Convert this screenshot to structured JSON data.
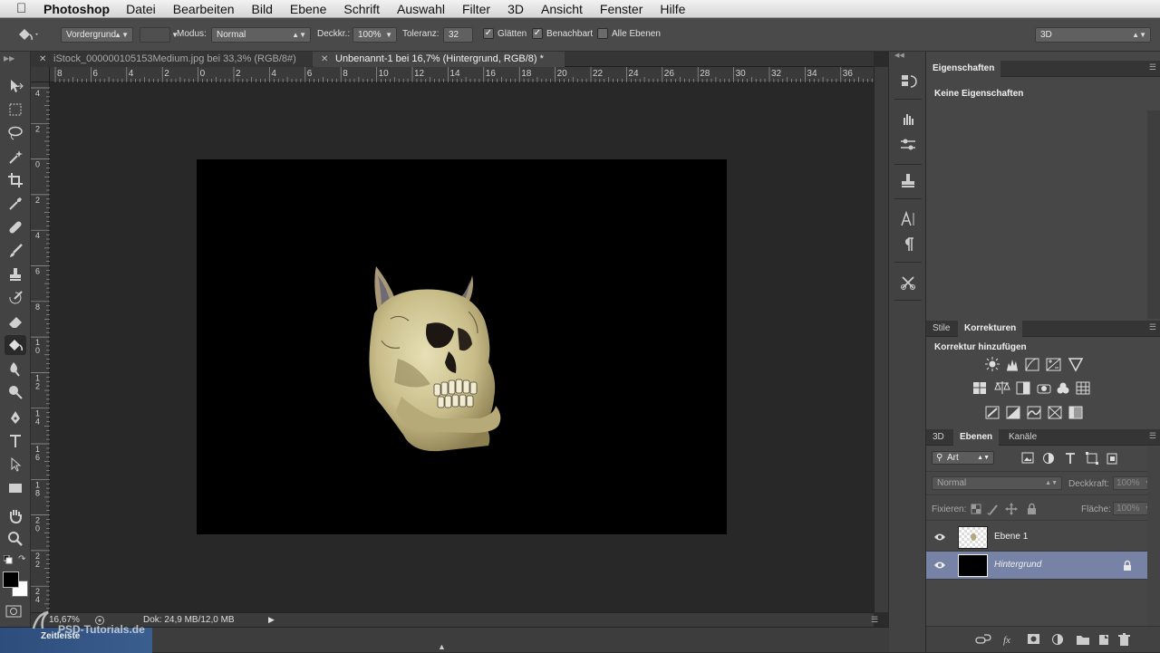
{
  "menubar": {
    "app": "Photoshop",
    "items": [
      "Datei",
      "Bearbeiten",
      "Bild",
      "Ebene",
      "Schrift",
      "Auswahl",
      "Filter",
      "3D",
      "Ansicht",
      "Fenster",
      "Hilfe"
    ]
  },
  "options": {
    "fill_source": "Vordergrund",
    "mode_label": "Modus:",
    "mode_value": "Normal",
    "opacity_label": "Deckkr.:",
    "opacity_value": "100%",
    "tolerance_label": "Toleranz:",
    "tolerance_value": "32",
    "smooth_label": "Glätten",
    "contiguous_label": "Benachbart",
    "all_layers_label": "Alle Ebenen",
    "workspace": "3D"
  },
  "tabs": [
    {
      "label": "iStock_000000105153Medium.jpg bei 33,3% (RGB/8#)"
    },
    {
      "label": "Unbenannt-1 bei 16,7% (Hintergrund, RGB/8) *"
    }
  ],
  "ruler_h": [
    "8",
    "6",
    "4",
    "2",
    "0",
    "2",
    "4",
    "6",
    "8",
    "10",
    "12",
    "14",
    "16",
    "18",
    "20",
    "22",
    "24",
    "26",
    "28",
    "30",
    "32",
    "34",
    "36"
  ],
  "ruler_v": [
    "4",
    "2",
    "0",
    "2",
    "4",
    "6",
    "8",
    "1 0",
    "1 2",
    "1 4",
    "1 6",
    "1 8",
    "2 0",
    "2 2",
    "2 4"
  ],
  "status": {
    "zoom": "16,67%",
    "doc": "Dok: 24,9 MB/12,0 MB"
  },
  "watermark": "PSD-Tutorials.de",
  "timeline": {
    "label": "Zeitleiste"
  },
  "properties": {
    "tab": "Eigenschaften",
    "empty": "Keine Eigenschaften"
  },
  "adjustments": {
    "tabs": [
      "Stile",
      "Korrekturen"
    ],
    "title": "Korrektur hinzufügen"
  },
  "layers_panel": {
    "tabs": [
      "3D",
      "Ebenen",
      "Kanäle"
    ],
    "filter": "Art",
    "blend": "Normal",
    "opacity_label": "Deckkraft:",
    "opacity": "100%",
    "lock_label": "Fixieren:",
    "fill_label": "Fläche:",
    "fill": "100%",
    "layers": [
      {
        "name": "Ebene 1",
        "selected": false
      },
      {
        "name": "Hintergrund",
        "selected": true
      }
    ]
  },
  "colors": {
    "accent": "#7782a7",
    "canvas": "#000000"
  }
}
